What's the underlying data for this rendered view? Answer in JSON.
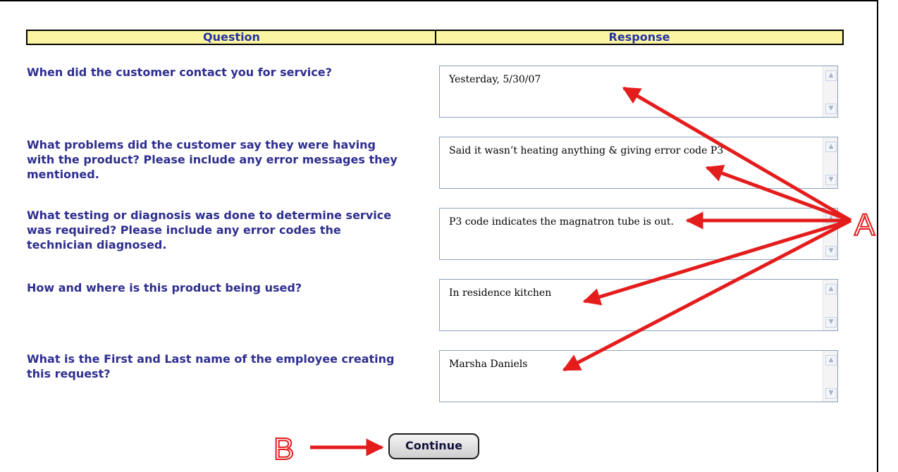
{
  "table": {
    "question_header": "Question",
    "response_header": "Response"
  },
  "rows": [
    {
      "question": [
        "When did the customer contact you for service?"
      ],
      "response": "Yesterday, 5/30/07"
    },
    {
      "question": [
        "What problems did the customer say they were having",
        "with the product? Please include any error messages they",
        "mentioned."
      ],
      "response": "Said it wasn’t heating anything & giving error code P3"
    },
    {
      "question": [
        "What testing or diagnosis was done to determine service",
        "was required? Please include any error codes the",
        "technician diagnosed."
      ],
      "response": "P3 code indicates the magnatron tube is out."
    },
    {
      "question": [
        "How and where is this product being used?"
      ],
      "response": "In residence kitchen"
    },
    {
      "question": [
        "What is the First and Last name of the employee creating",
        "this request?"
      ],
      "response": "Marsha Daniels"
    }
  ],
  "continue_label": "Continue",
  "annotations": {
    "a_label": "A",
    "b_label": "B",
    "arrow_color": "#e41c1c"
  },
  "colors": {
    "header_bg": "#fbf5a3",
    "question_text": "#2e2e8f",
    "header_text": "#2434a3"
  },
  "icons": {
    "scroll_up": "scroll-up-arrow-icon",
    "scroll_down": "scroll-down-arrow-icon"
  }
}
